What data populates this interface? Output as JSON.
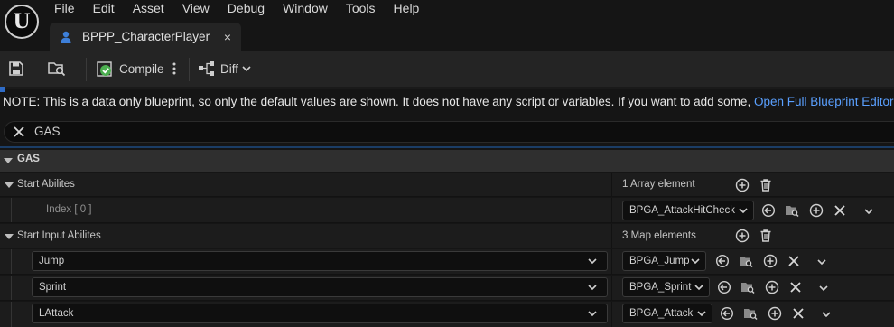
{
  "app": {
    "logo_text": "U"
  },
  "menu": [
    "File",
    "Edit",
    "Asset",
    "View",
    "Debug",
    "Window",
    "Tools",
    "Help"
  ],
  "tab": {
    "title": "BPPP_CharacterPlayer",
    "close_glyph": "×"
  },
  "toolbar": {
    "compile_label": "Compile",
    "diff_label": "Diff"
  },
  "note": {
    "text": "NOTE: This is a data only blueprint, so only the default values are shown.  It does not have any script or variables.  If you want to add some, ",
    "link": "Open Full Blueprint Editor"
  },
  "search": {
    "value": "GAS"
  },
  "category": {
    "label": "GAS"
  },
  "start_abilities": {
    "label": "Start Abilites",
    "count_text": "1 Array element",
    "items": [
      {
        "index_label": "Index [ 0 ]",
        "value": "BPGA_AttackHitCheck"
      }
    ]
  },
  "start_input_abilities": {
    "label": "Start Input Abilites",
    "count_text": "3 Map elements",
    "items": [
      {
        "key": "Jump",
        "value": "BPGA_Jump"
      },
      {
        "key": "Sprint",
        "value": "BPGA_Sprint"
      },
      {
        "key": "LAttack",
        "value": "BPGA_Attack"
      }
    ]
  },
  "colors": {
    "accent": "#2f6cc7",
    "link": "#5aa0ff",
    "compile_ok": "#4caf50"
  }
}
